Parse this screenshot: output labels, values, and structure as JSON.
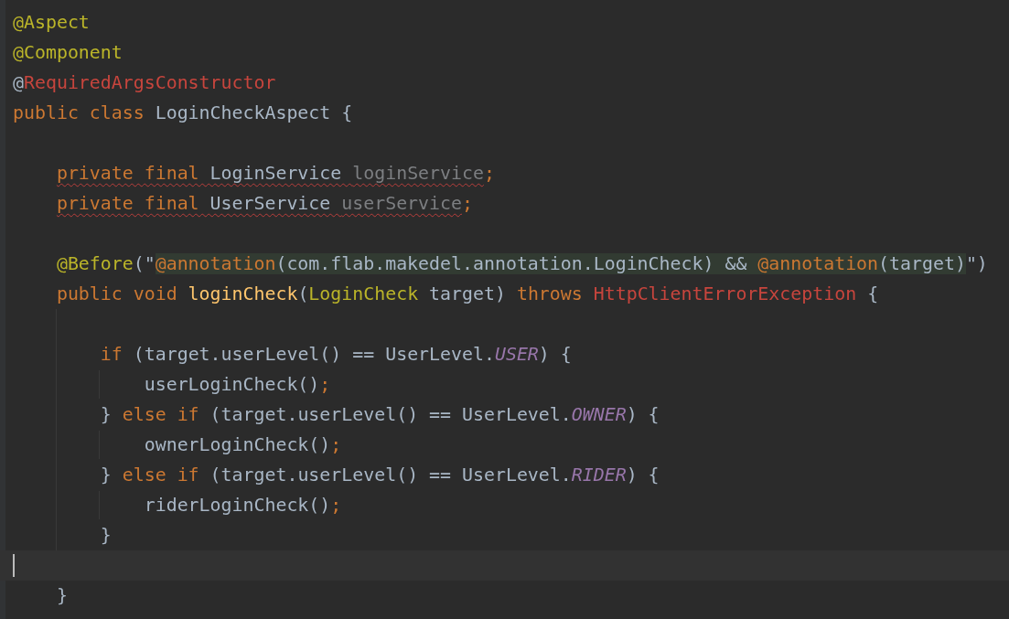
{
  "editor": {
    "lines": [
      {
        "tokens": [
          {
            "text": "@Aspect",
            "kind": "annotation"
          }
        ]
      },
      {
        "tokens": [
          {
            "text": "@Component",
            "kind": "annotation"
          }
        ]
      },
      {
        "tokens": [
          {
            "text": "@",
            "kind": "plain"
          },
          {
            "text": "RequiredArgsConstructor",
            "kind": "unresolved"
          }
        ]
      },
      {
        "tokens": [
          {
            "text": "public class ",
            "kind": "keyword"
          },
          {
            "text": "LoginCheckAspect {",
            "kind": "plain"
          }
        ]
      },
      {
        "blank_before": true,
        "tokens": [
          {
            "text": "    private final ",
            "kind": "keyword",
            "error": true
          },
          {
            "text": "LoginService ",
            "kind": "plain",
            "error": true
          },
          {
            "text": "loginService",
            "kind": "unused",
            "error": true
          },
          {
            "text": ";",
            "kind": "keyword"
          }
        ]
      },
      {
        "tokens": [
          {
            "text": "    private final ",
            "kind": "keyword",
            "error": true
          },
          {
            "text": "UserService ",
            "kind": "plain",
            "error": true
          },
          {
            "text": "userService",
            "kind": "unused",
            "error": true
          },
          {
            "text": ";",
            "kind": "keyword"
          }
        ]
      },
      {
        "blank_before": true,
        "tokens": [
          {
            "text": "    @Before",
            "kind": "annotation"
          },
          {
            "text": "(\"",
            "kind": "plain"
          },
          {
            "text": "@annotation",
            "kind": "keyword",
            "injected": true
          },
          {
            "text": "(com.flab.makedel.annotation.LoginCheck) && ",
            "kind": "plain",
            "injected": true
          },
          {
            "text": "@annotation",
            "kind": "keyword",
            "injected": true
          },
          {
            "text": "(target)",
            "kind": "plain",
            "injected": true
          },
          {
            "text": "\")",
            "kind": "plain"
          }
        ]
      },
      {
        "tokens": [
          {
            "text": "    public void ",
            "kind": "keyword"
          },
          {
            "text": "loginCheck",
            "kind": "method"
          },
          {
            "text": "(",
            "kind": "plain"
          },
          {
            "text": "LoginCheck ",
            "kind": "annotation"
          },
          {
            "text": "target) ",
            "kind": "plain"
          },
          {
            "text": "throws ",
            "kind": "keyword"
          },
          {
            "text": "HttpClientErrorException ",
            "kind": "unresolved"
          },
          {
            "text": "{",
            "kind": "plain"
          }
        ]
      },
      {
        "blank_before": true,
        "tokens": [
          {
            "text": "        if ",
            "kind": "keyword"
          },
          {
            "text": "(target.userLevel() == UserLevel.",
            "kind": "plain"
          },
          {
            "text": "USER",
            "kind": "constant"
          },
          {
            "text": ") {",
            "kind": "plain"
          }
        ]
      },
      {
        "tokens": [
          {
            "text": "            userLoginCheck()",
            "kind": "plain"
          },
          {
            "text": ";",
            "kind": "keyword"
          }
        ]
      },
      {
        "tokens": [
          {
            "text": "        } ",
            "kind": "plain"
          },
          {
            "text": "else if ",
            "kind": "keyword"
          },
          {
            "text": "(target.userLevel() == UserLevel.",
            "kind": "plain"
          },
          {
            "text": "OWNER",
            "kind": "constant"
          },
          {
            "text": ") {",
            "kind": "plain"
          }
        ]
      },
      {
        "tokens": [
          {
            "text": "            ownerLoginCheck()",
            "kind": "plain"
          },
          {
            "text": ";",
            "kind": "keyword"
          }
        ]
      },
      {
        "tokens": [
          {
            "text": "        } ",
            "kind": "plain"
          },
          {
            "text": "else if ",
            "kind": "keyword"
          },
          {
            "text": "(target.userLevel() == UserLevel.",
            "kind": "plain"
          },
          {
            "text": "RIDER",
            "kind": "constant"
          },
          {
            "text": ") {",
            "kind": "plain"
          }
        ]
      },
      {
        "tokens": [
          {
            "text": "            riderLoginCheck()",
            "kind": "plain"
          },
          {
            "text": ";",
            "kind": "keyword"
          }
        ]
      },
      {
        "tokens": [
          {
            "text": "        }",
            "kind": "plain"
          }
        ]
      },
      {
        "current": true
      },
      {
        "tokens": [
          {
            "text": "    }",
            "kind": "plain"
          }
        ]
      }
    ]
  }
}
